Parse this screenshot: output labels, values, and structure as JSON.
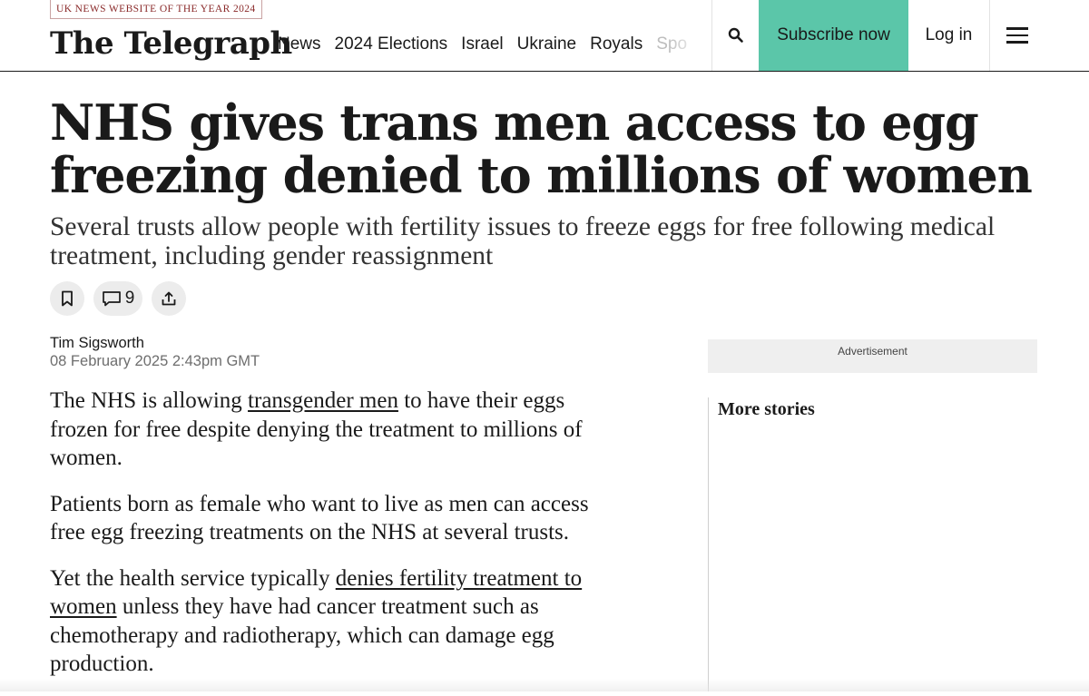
{
  "header": {
    "award": "UK NEWS WEBSITE OF THE YEAR 2024",
    "logo": "The Telegraph",
    "nav": [
      "News",
      "2024 Elections",
      "Israel",
      "Ukraine",
      "Royals",
      "Spo"
    ],
    "search_icon": "search-icon",
    "subscribe_label": "Subscribe now",
    "login_label": "Log in",
    "menu_icon": "hamburger-menu-icon",
    "accent_color": "#5bc6a9"
  },
  "article": {
    "headline": "NHS gives trans men access to egg freezing denied to millions of women",
    "standfirst": "Several trusts allow people with fertility issues to freeze eggs for free following medical treatment, including gender reassignment",
    "actions": {
      "bookmark_icon": "bookmark-icon",
      "comment_icon": "comment-icon",
      "comment_count": "9",
      "share_icon": "share-icon"
    },
    "author": "Tim Sigsworth",
    "date": "08 February 2025 2:43pm GMT",
    "paragraphs": [
      {
        "before": "The NHS is allowing ",
        "link": "transgender men",
        "after": " to have their eggs frozen for free despite denying the treatment to millions of women."
      },
      {
        "text": "Patients born as female who want to live as men can access free egg freezing treatments on the NHS at several trusts."
      },
      {
        "before": "Yet the health service typically ",
        "link": "denies fertility treatment to women",
        "after": " unless they have had cancer treatment such as chemotherapy and radiotherapy, which can damage egg production."
      }
    ]
  },
  "sidebar": {
    "advert_label": "Advertisement",
    "more_stories_title": "More stories"
  }
}
